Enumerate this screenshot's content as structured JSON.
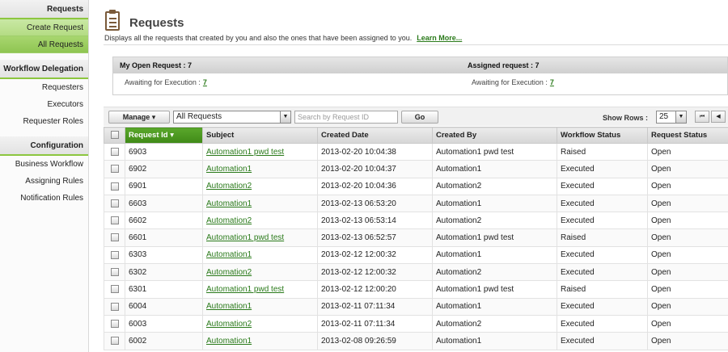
{
  "sidebar": {
    "requests_header": "Requests",
    "requests_items": [
      "Create Request",
      "All Requests"
    ],
    "workflow_header": "Workflow Delegation",
    "workflow_items": [
      "Requesters",
      "Executors",
      "Requester Roles"
    ],
    "config_header": "Configuration",
    "config_items": [
      "Business Workflow",
      "Assigning Rules",
      "Notification Rules"
    ]
  },
  "header": {
    "title": "Requests",
    "icon": "clipboard-icon",
    "description": "Displays all the requests that created by you and also the ones that have been assigned to you.",
    "learn_more": "Learn More..."
  },
  "summary": {
    "open_label": "My Open Request : 7",
    "assigned_label": "Assigned request : 7",
    "awaiting_left_label": "Awaiting for Execution :",
    "awaiting_left_value": "7",
    "awaiting_right_label": "Awaiting for Execution :",
    "awaiting_right_value": "7"
  },
  "toolbar": {
    "manage_label": "Manage",
    "filter_value": "All Requests",
    "search_placeholder": "Search by Request ID",
    "go_label": "Go",
    "show_rows_label": "Show Rows :",
    "rows_value": "25"
  },
  "table": {
    "columns": [
      "Request Id",
      "Subject",
      "Created Date",
      "Created By",
      "Workflow Status",
      "Request Status"
    ],
    "rows": [
      [
        "6903",
        "Automation1 pwd test",
        "2013-02-20 10:04:38",
        "Automation1 pwd test",
        "Raised",
        "Open"
      ],
      [
        "6902",
        "Automation1",
        "2013-02-20 10:04:37",
        "Automation1",
        "Executed",
        "Open"
      ],
      [
        "6901",
        "Automation2",
        "2013-02-20 10:04:36",
        "Automation2",
        "Executed",
        "Open"
      ],
      [
        "6603",
        "Automation1",
        "2013-02-13 06:53:20",
        "Automation1",
        "Executed",
        "Open"
      ],
      [
        "6602",
        "Automation2",
        "2013-02-13 06:53:14",
        "Automation2",
        "Executed",
        "Open"
      ],
      [
        "6601",
        "Automation1 pwd test",
        "2013-02-13 06:52:57",
        "Automation1 pwd test",
        "Raised",
        "Open"
      ],
      [
        "6303",
        "Automation1",
        "2013-02-12 12:00:32",
        "Automation1",
        "Executed",
        "Open"
      ],
      [
        "6302",
        "Automation2",
        "2013-02-12 12:00:32",
        "Automation2",
        "Executed",
        "Open"
      ],
      [
        "6301",
        "Automation1 pwd test",
        "2013-02-12 12:00:20",
        "Automation1 pwd test",
        "Raised",
        "Open"
      ],
      [
        "6004",
        "Automation1",
        "2013-02-11 07:11:34",
        "Automation1",
        "Executed",
        "Open"
      ],
      [
        "6003",
        "Automation2",
        "2013-02-11 07:11:34",
        "Automation2",
        "Executed",
        "Open"
      ],
      [
        "6002",
        "Automation1",
        "2013-02-08 09:26:59",
        "Automation1",
        "Executed",
        "Open"
      ]
    ]
  },
  "colors": {
    "accent_green": "#3f8a17",
    "link_green": "#2a7a1a"
  }
}
